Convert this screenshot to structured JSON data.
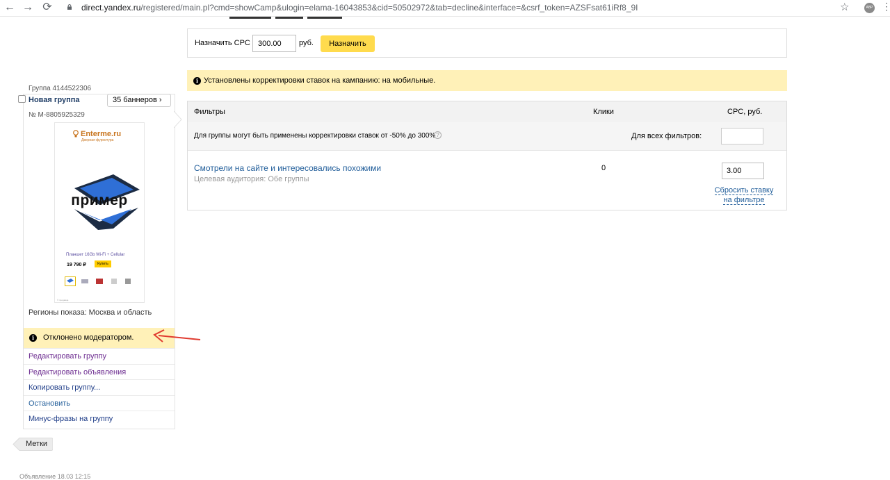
{
  "browser": {
    "url_host": "direct.yandex.ru",
    "url_path": "/registered/main.pl?cmd=showCamp&ulogin=elama-16043853&cid=50502972&tab=decline&interface=&csrf_token=AZSFsat61iRf8_9I",
    "ext_label": "ABP"
  },
  "bid_bar": {
    "label": "Назначить CPC",
    "value": "300.00",
    "currency": "руб.",
    "button": "Назначить"
  },
  "warning": {
    "text": "Установлены корректировки ставок на кампанию: на мобильные."
  },
  "table": {
    "headers": {
      "filters": "Фильтры",
      "clicks": "Клики",
      "cpc": "CPC, руб."
    },
    "adjust_note": "Для группы могут быть применены корректировки ставок от -50% до 300%",
    "all_filters_label": "Для всех фильтров:",
    "all_filters_value": "",
    "row": {
      "filter": "Смотрели на сайте и интересовались похожими",
      "audience": "Целевая аудитория: Обе группы",
      "clicks": "0",
      "cpc": "3.00",
      "reset_line1": "Сбросить ставку",
      "reset_line2": "на фильтре"
    }
  },
  "group": {
    "id_label": "Группа 4144522306",
    "name": "Новая группа",
    "banners": "35 баннеров",
    "number": "№ M-8805925329",
    "ad": {
      "logo": "Enterme.ru",
      "logo_sub": "Дверная фурнитура",
      "headline": "пример",
      "product": "Планшет 16Gb Wi-Fi + Cellular",
      "price": "19 790 ₽",
      "buy": "Купить",
      "disclaimer": "© продавца"
    },
    "regions": "Регионы показа: Москва и область",
    "status": "Отклонено модератором.",
    "actions": [
      {
        "label": "Редактировать группу",
        "color": "#6b2a8f"
      },
      {
        "label": "Редактировать объявления",
        "color": "#6b2a8f"
      },
      {
        "label": "Копировать группу...",
        "color": "#1f3d88"
      },
      {
        "label": "Остановить",
        "color": "#1f5c99"
      },
      {
        "label": "Минус-фразы на группу",
        "color": "#1f3d88"
      }
    ]
  },
  "tags_button": "Метки",
  "footer_cut": "Объявление 18.03 12:15",
  "colors": {
    "yellow": "#ffdb4d",
    "banner_bg": "#fff1b8",
    "link": "#1f5c99",
    "arrow": "#e03a2f"
  }
}
